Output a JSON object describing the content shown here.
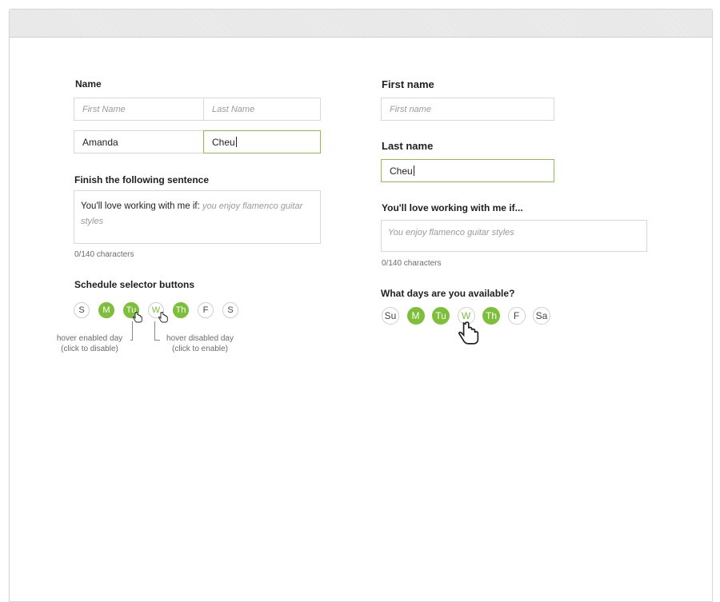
{
  "left": {
    "name_label": "Name",
    "first_placeholder": "First Name",
    "last_placeholder": "Last Name",
    "first_value": "Amanda",
    "last_value": "Cheu",
    "sentence_label": "Finish the following sentence",
    "sentence_prefix": "You'll love working with me if:",
    "sentence_placeholder": "you enjoy flamenco guitar styles",
    "char_count": "0/140 characters",
    "schedule_label": "Schedule selector buttons",
    "days": [
      "S",
      "M",
      "Tu",
      "W",
      "Th",
      "F",
      "S"
    ],
    "days_selected": [
      false,
      true,
      true,
      false,
      true,
      false,
      false
    ],
    "note_enabled_line1": "hover enabled day",
    "note_enabled_line2": "(click to disable)",
    "note_disabled_line1": "hover disabled day",
    "note_disabled_line2": "(click to enable)"
  },
  "right": {
    "first_label": "First name",
    "first_placeholder": "First name",
    "last_label": "Last name",
    "last_value": "Cheu",
    "sentence_label": "You'll love working with me if...",
    "sentence_placeholder": "You enjoy flamenco guitar styles",
    "char_count": "0/140 characters",
    "days_label": "What days are you available?",
    "days": [
      "Su",
      "M",
      "Tu",
      "W",
      "Th",
      "F",
      "Sa"
    ],
    "days_selected": [
      false,
      true,
      true,
      false,
      true,
      false,
      false
    ]
  },
  "colors": {
    "accent": "#7dbf3b",
    "focus_border": "#8cc04a"
  },
  "icons": [
    "hand-cursor-icon"
  ]
}
